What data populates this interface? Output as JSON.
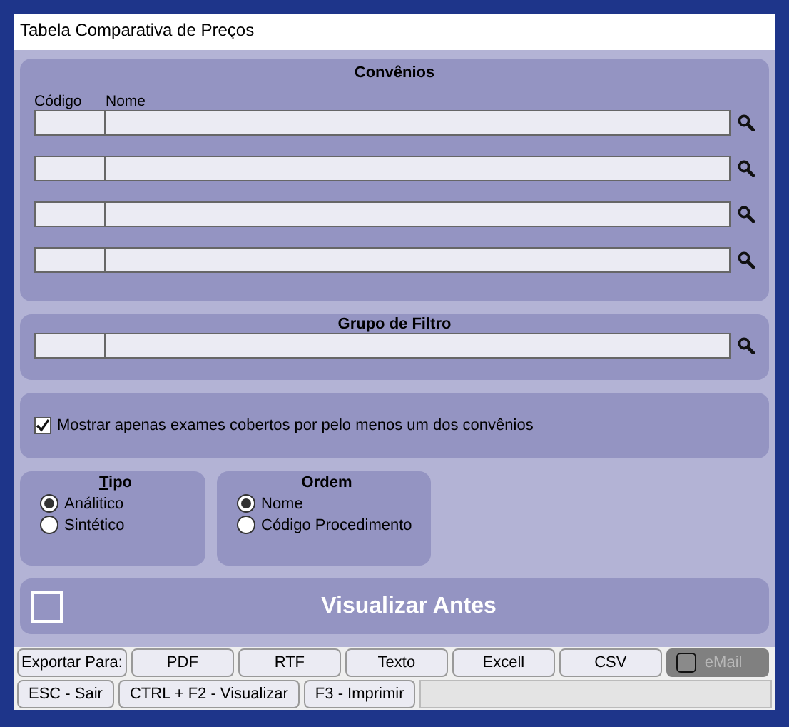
{
  "window": {
    "title": "Tabela Comparativa de Preços"
  },
  "convenios": {
    "title": "Convênios",
    "columns": [
      "Código",
      "Nome"
    ]
  },
  "grupo_filtro": {
    "title": "Grupo de Filtro"
  },
  "filter_checkbox": {
    "label": "Mostrar apenas exames cobertos por pelo menos um dos convênios",
    "checked": true
  },
  "tipo": {
    "title": "Tipo",
    "options": [
      {
        "label": "Análitico",
        "selected": true
      },
      {
        "label": "Sintético",
        "selected": false
      }
    ]
  },
  "ordem": {
    "title": "Ordem",
    "options": [
      {
        "label": "Nome",
        "selected": true
      },
      {
        "label": "Código Procedimento",
        "selected": false
      }
    ]
  },
  "preview": {
    "label": "Visualizar Antes",
    "checked": false
  },
  "export": {
    "label": "Exportar Para:",
    "buttons": [
      "PDF",
      "RTF",
      "Texto",
      "Excell",
      "CSV"
    ],
    "email": {
      "label": "eMail",
      "checked": false,
      "disabled": true
    }
  },
  "actions": [
    "ESC - Sair",
    "CTRL + F2 - Visualizar",
    "F3 - Imprimir"
  ]
}
